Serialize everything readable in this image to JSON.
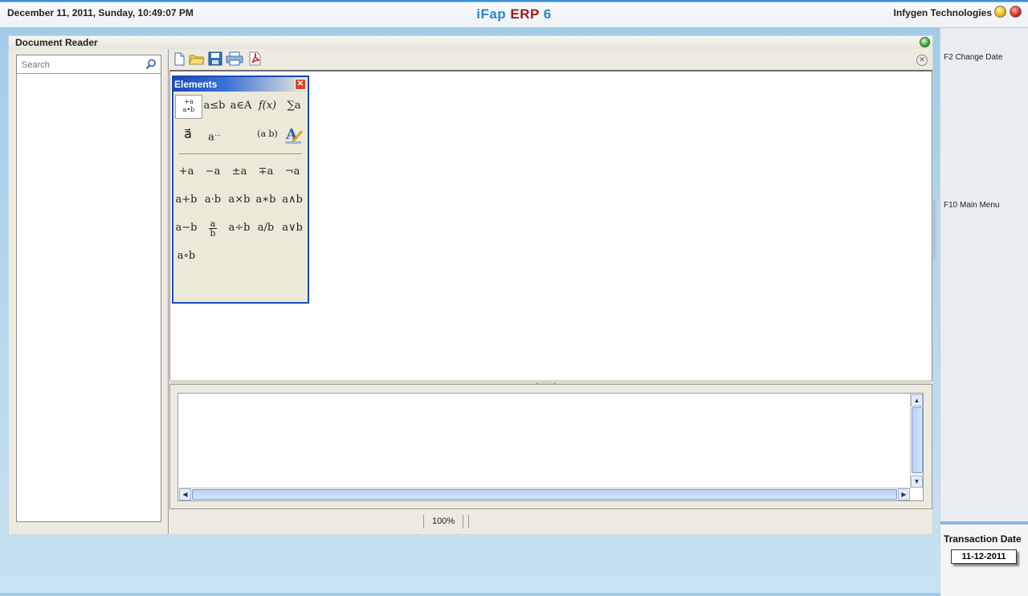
{
  "header": {
    "datetime": "December  11, 2011, Sunday, 10:49:07 PM",
    "brand_part1": "iFap",
    "brand_part2": "ERP",
    "brand_part3": "6",
    "company": "Infygen Technologies"
  },
  "window": {
    "title": "Document Reader"
  },
  "search": {
    "placeholder": "Search"
  },
  "toolbar": {
    "buttons": [
      "new-document-icon",
      "open-folder-icon",
      "save-icon",
      "print-icon",
      "export-pdf-icon"
    ]
  },
  "elements_panel": {
    "title": "Elements",
    "close": "✕",
    "categories": [
      "+a a•b",
      "a≤b",
      "a∈A",
      "f(x)",
      "∑a",
      "a⃗",
      "a…",
      "(a b)",
      "A✎"
    ],
    "operators": [
      "+a",
      "−a",
      "±a",
      "∓a",
      "¬a",
      "a+b",
      "a·b",
      "a×b",
      "a∗b",
      "a∧b",
      "a−b",
      "a/b",
      "a÷b",
      "a/b",
      "a∨b",
      "a∘b"
    ]
  },
  "statusbar": {
    "zoom": "100%"
  },
  "right_panel": {
    "f2": "F2 Change Date",
    "f10": "F10 Main Menu",
    "transaction_label": "Transaction Date",
    "transaction_date": "11-12-2011"
  },
  "colors": {
    "brand_blue": "#2b86c8",
    "brand_red": "#9b1c1c",
    "title_bar_blue": "#1b4bb8"
  }
}
